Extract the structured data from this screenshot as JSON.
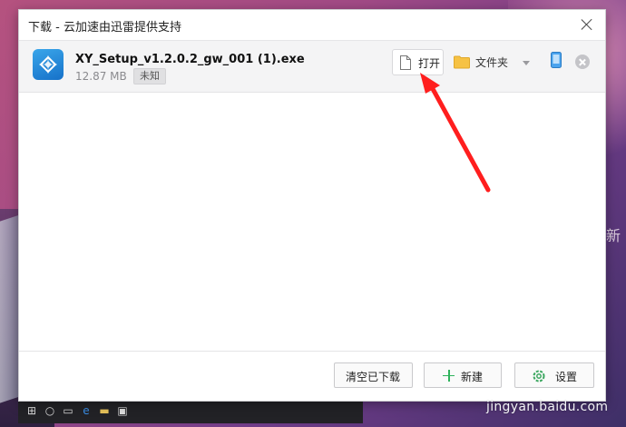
{
  "window": {
    "title": "下载 - 云加速由迅雷提供支持"
  },
  "download": {
    "filename": "XY_Setup_v1.2.0.2_gw_001 (1).exe",
    "size": "12.87 MB",
    "status": "未知",
    "open_label": "打开",
    "folder_label": "文件夹"
  },
  "footer": {
    "clear_label": "清空已下载",
    "new_label": "新建",
    "settings_label": "设置"
  },
  "background": {
    "side_text": "新",
    "watermark": "jingyan.baidu.com"
  },
  "colors": {
    "accent_green": "#2fb35c",
    "app_icon_blue": "#1f86d8",
    "annotation_red": "#ff1e1e"
  },
  "icons": [
    "close-icon",
    "file-icon",
    "folder-icon",
    "chevron-down-icon",
    "phone-icon",
    "remove-icon",
    "plus-icon",
    "gear-icon"
  ]
}
